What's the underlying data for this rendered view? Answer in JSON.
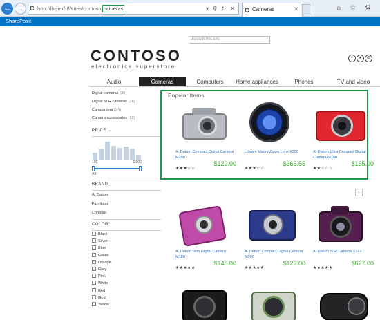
{
  "browser": {
    "url_prefix": "http://lb-perf-8/sites/contoso/",
    "url_highlight": "cameras",
    "url_tools": "▾ ⚲ ↻ ✕",
    "tab_title": "Cameras",
    "favicon": "C",
    "window_icons": "⌂ ☆ ⚙"
  },
  "sharepoint": {
    "label": "SharePoint"
  },
  "site": {
    "search_placeholder": "Search this site",
    "logo": "CONTOSO",
    "tagline": "electronics superstore"
  },
  "topnav": [
    {
      "label": "Audio",
      "active": false
    },
    {
      "label": "Cameras",
      "active": true
    },
    {
      "label": "Computers",
      "active": false
    },
    {
      "label": "Home appliances",
      "active": false
    },
    {
      "label": "Phones",
      "active": false
    },
    {
      "label": "TV and video",
      "active": false
    }
  ],
  "filters": {
    "categories": [
      {
        "label": "Digital cameras",
        "count": "(36)"
      },
      {
        "label": "Digital SLR cameras",
        "count": "(26)"
      },
      {
        "label": "Camcorders",
        "count": "(24)"
      },
      {
        "label": "Camera accessories",
        "count": "(12)"
      }
    ],
    "price": {
      "title": "PRICE",
      "min_label": "100",
      "max_label": "1,000",
      "all_label": "All",
      "histogram": [
        0.35,
        0.55,
        0.9,
        0.7,
        0.6,
        0.65,
        0.55,
        0.25
      ]
    },
    "brand": {
      "title": "BRAND",
      "items": [
        "A. Datum",
        "Fabrikam",
        "Contoso"
      ]
    },
    "color": {
      "title": "COLOR",
      "items": [
        "Black",
        "Silver",
        "Blue",
        "Green",
        "Orange",
        "Grey",
        "Pink",
        "White",
        "Red",
        "Gold",
        "Yellow"
      ]
    }
  },
  "popular": {
    "title": "Popular Items"
  },
  "products": [
    {
      "name": "A. Datum Compact Digital Camera M200",
      "stars": "★★★☆☆",
      "price": "$129.00",
      "camera": "silver"
    },
    {
      "name": "Litware Macro Zoom Lens X300",
      "stars": "★★★☆☆",
      "price": "$366.55",
      "camera": "lens"
    },
    {
      "name": "A. Datum Ultra Compact Digital Camera M190",
      "stars": "★★☆☆☆",
      "price": "$165.00",
      "camera": "red"
    },
    {
      "name": "A. Datum Slim Digital Camera M180",
      "stars": "★★★★★",
      "price": "$148.00",
      "camera": "pink"
    },
    {
      "name": "A. Datum Compact Digital Camera M200",
      "stars": "★★★★★",
      "price": "$129.00",
      "camera": "navy"
    },
    {
      "name": "A. Datum SLR Camera X142",
      "stars": "★★★★★",
      "price": "$627.00",
      "camera": "purple"
    }
  ],
  "scroll_icon": "‹",
  "colors": {
    "accent": "#0072c6",
    "highlight": "#1f9a4a",
    "price": "#3aa62f",
    "link": "#2a6ebb"
  }
}
